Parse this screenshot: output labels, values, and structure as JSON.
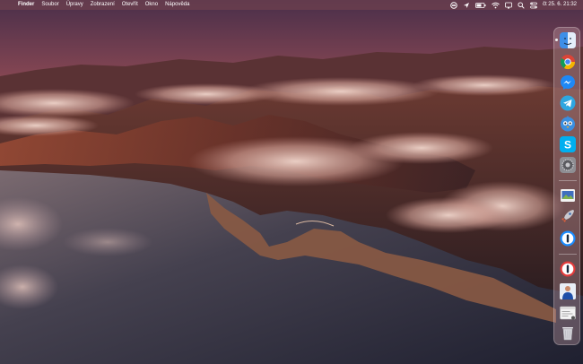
{
  "menubar": {
    "apple_glyph": "",
    "app_name": "Finder",
    "menus": [
      "Soubor",
      "Úpravy",
      "Zobrazení",
      "Otevřít",
      "Okno",
      "Nápověda"
    ],
    "status_icons": [
      "creative-cloud-icon",
      "location-arrow-icon",
      "battery-icon",
      "wifi-icon",
      "display-icon",
      "search-icon",
      "control-center-icon"
    ],
    "clock": "čt 25. 6.  21:32"
  },
  "dock": {
    "items": [
      {
        "name": "finder-icon",
        "running": true
      },
      {
        "name": "chrome-icon",
        "running": false
      },
      {
        "name": "messenger-icon",
        "running": false
      },
      {
        "name": "telegram-icon",
        "running": false
      },
      {
        "name": "tweetbot-icon",
        "running": false
      },
      {
        "name": "skype-icon",
        "running": false
      },
      {
        "name": "system-preferences-icon",
        "running": false
      },
      {
        "name": "preview-icon",
        "running": false
      },
      {
        "name": "launchpad-rocket-icon",
        "running": false
      },
      {
        "name": "1password-icon",
        "running": false
      },
      {
        "name": "1password-mini-icon",
        "running": false
      },
      {
        "name": "user-photo-icon",
        "running": false
      },
      {
        "name": "screenshot-window-icon",
        "running": false
      },
      {
        "name": "trash-icon",
        "running": false
      }
    ]
  },
  "colors": {
    "sky_top": "#5a3346",
    "sky_glow": "#f0805a",
    "mountain": "#4a2a2a",
    "sea": "#3b3c4e"
  }
}
